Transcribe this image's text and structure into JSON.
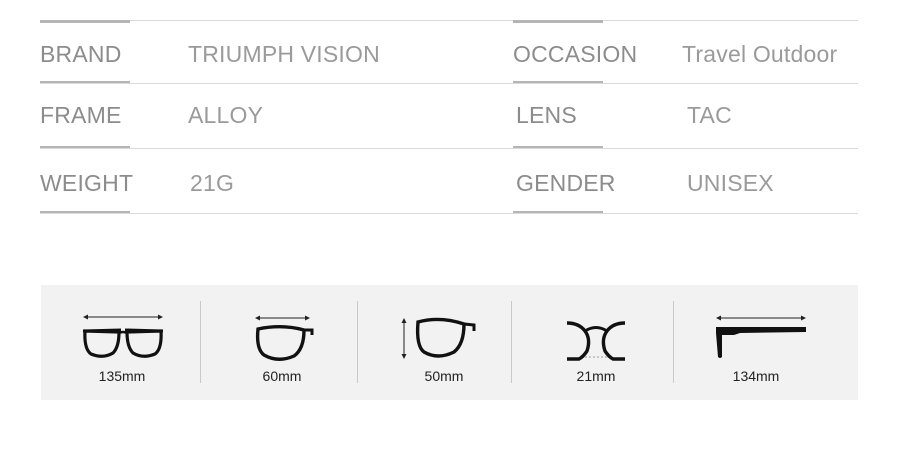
{
  "specs": {
    "rows": [
      {
        "left_label": "BRAND",
        "left_value": "TRIUMPH VISION",
        "right_label": "OCCASION",
        "right_value": "Travel Outdoor"
      },
      {
        "left_label": "FRAME",
        "left_value": "ALLOY",
        "right_label": "LENS",
        "right_value": "TAC"
      },
      {
        "left_label": "WEIGHT",
        "left_value": "21G",
        "right_label": "GENDER",
        "right_value": "UNISEX"
      }
    ]
  },
  "measurements": [
    {
      "icon": "frame-width-icon",
      "label": "135mm"
    },
    {
      "icon": "lens-width-icon",
      "label": "60mm"
    },
    {
      "icon": "lens-height-icon",
      "label": "50mm"
    },
    {
      "icon": "bridge-width-icon",
      "label": "21mm"
    },
    {
      "icon": "temple-length-icon",
      "label": "134mm"
    }
  ],
  "colors": {
    "text_gray": "#8a8a8a",
    "accent_line": "#b5b5b5",
    "divider_line": "#dadada",
    "panel_bg": "#f2f2f2",
    "icon_black": "#111111"
  }
}
